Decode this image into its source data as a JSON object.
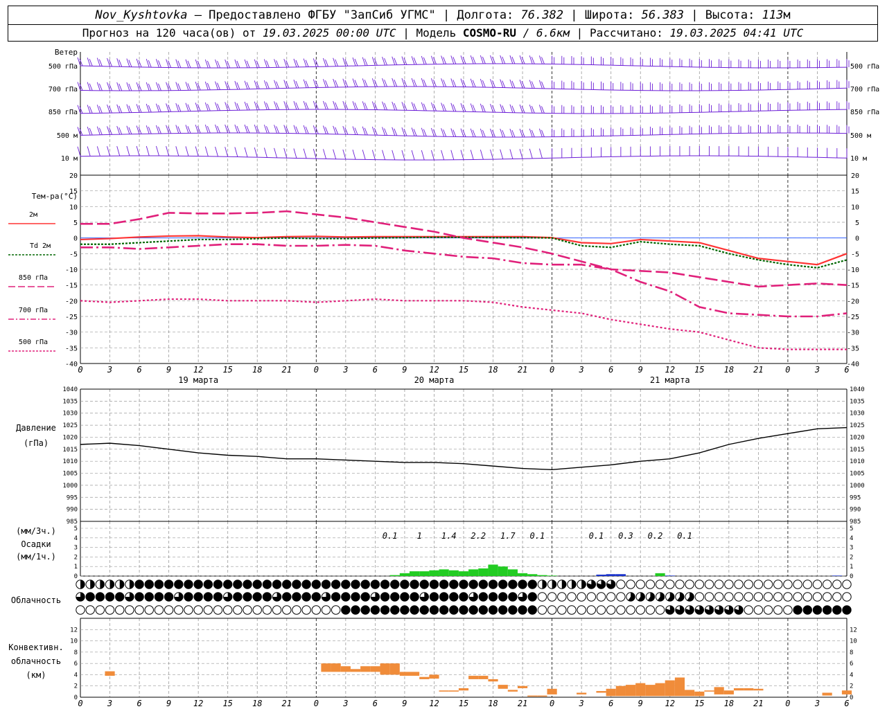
{
  "header": {
    "station": "Nov_Kyshtovka",
    "provider": "— Предоставлено ФГБУ \"ЗапСиб УГМС\"",
    "lon_label": "| Долгота:",
    "lon": "76.382",
    "lat_label": "| Широта:",
    "lat": "56.383",
    "alt_label": "| Высота:",
    "alt": "113",
    "alt_unit": "м",
    "forecast_label": "Прогноз на 120 часа(ов) от",
    "forecast_start": "19.03.2025 00:00 UTC",
    "model_label": "| Модель",
    "model": "COSMO-RU",
    "resolution": "/ 6.6км",
    "calc_label": "| Рассчитано:",
    "calc_time": "19.03.2025 04:41 UTC"
  },
  "labels": {
    "wind": "Ветер",
    "wind_levels": [
      "500 гПа",
      "700 гПа",
      "850 гПа",
      "500 м",
      "10 м"
    ],
    "temp": "Тем-ра(°С)",
    "temp_legend": [
      "2м",
      "Td 2м",
      "850 гПа",
      "700 гПа",
      "500 гПа"
    ],
    "pressure": "Давление",
    "pressure_unit": "(гПа)",
    "precip_3h": "(мм/3ч.)",
    "precip": "Осадки",
    "precip_1h": "(мм/1ч.)",
    "cloud": "Облачность",
    "conv1": "Конвективн.",
    "conv2": "облачность",
    "conv3": "(км)",
    "days": [
      "19 марта",
      "20 марта",
      "21 марта"
    ]
  },
  "chart_data": [
    {
      "type": "line",
      "title": "Тем-ра(°С)",
      "x_hours": [
        0,
        3,
        6,
        9,
        12,
        15,
        18,
        21,
        24,
        27,
        30,
        33,
        36,
        39,
        42,
        45,
        48,
        51,
        54,
        57,
        60,
        63,
        66,
        69,
        72,
        75,
        78
      ],
      "x_tick_labels": [
        "0",
        "3",
        "6",
        "9",
        "12",
        "15",
        "18",
        "21",
        "0",
        "3",
        "6",
        "9",
        "12",
        "15",
        "18",
        "21",
        "0",
        "3",
        "6",
        "9",
        "12",
        "15",
        "18",
        "21",
        "0",
        "3",
        "6"
      ],
      "ylim": [
        -40,
        20
      ],
      "y_ticks": [
        20,
        15,
        10,
        5,
        0,
        -5,
        -10,
        -15,
        -20,
        -25,
        -30,
        -35,
        -40
      ],
      "series": [
        {
          "name": "2м",
          "color": "#ff3333",
          "values": [
            -0.5,
            -0.2,
            0.3,
            0.6,
            0.7,
            0.3,
            0.1,
            0.4,
            0.5,
            0.3,
            0.4,
            0.4,
            0.4,
            0.4,
            0.4,
            0.4,
            0.1,
            -1.5,
            -1.8,
            -0.5,
            -1,
            -1.5,
            -4,
            -6.5,
            -7.5,
            -8.5,
            -5
          ]
        },
        {
          "name": "Td 2м",
          "color": "#006600",
          "values": [
            -2,
            -2,
            -1.5,
            -1,
            -0.5,
            -0.5,
            -0.2,
            0,
            -0.2,
            -0.2,
            0,
            0.1,
            0.2,
            0.2,
            0.1,
            0.1,
            0,
            -2.5,
            -3,
            -1.2,
            -2,
            -2.5,
            -5,
            -7,
            -8.5,
            -9.5,
            -7
          ]
        },
        {
          "name": "850 гПа",
          "color": "#e0207a",
          "values": [
            4.5,
            4.5,
            6,
            8,
            7.8,
            7.8,
            8,
            8.5,
            7.5,
            6.5,
            5,
            3.5,
            2,
            0,
            -1.5,
            -3,
            -5,
            -7.5,
            -10,
            -10.5,
            -11,
            -12.5,
            -14,
            -15.5,
            -15,
            -14.5,
            -15
          ]
        },
        {
          "name": "700 гПа",
          "color": "#e0207a",
          "values": [
            -3,
            -3,
            -3.5,
            -3,
            -2.5,
            -2,
            -2,
            -2.5,
            -2.5,
            -2.2,
            -2.5,
            -4,
            -5,
            -6,
            -6.5,
            -8,
            -8.5,
            -8.5,
            -10,
            -14,
            -17,
            -22,
            -24,
            -24.5,
            -25,
            -25,
            -24
          ]
        },
        {
          "name": "500 гПа",
          "color": "#e0207a",
          "values": [
            -20,
            -20.5,
            -20,
            -19.5,
            -19.5,
            -20,
            -20,
            -20,
            -20.5,
            -20,
            -19.5,
            -20,
            -20,
            -20,
            -20.5,
            -22,
            -23,
            -24,
            -26,
            -27.5,
            -29,
            -30,
            -32.5,
            -35,
            -35.5,
            -35.5,
            -35.5
          ]
        }
      ]
    },
    {
      "type": "line",
      "title": "Давление",
      "ylabel": "(гПа)",
      "ylim": [
        985,
        1040
      ],
      "y_ticks": [
        1040,
        1035,
        1030,
        1025,
        1020,
        1015,
        1010,
        1005,
        1000,
        995,
        990,
        985
      ],
      "x_hours": [
        0,
        3,
        6,
        9,
        12,
        15,
        18,
        21,
        24,
        27,
        30,
        33,
        36,
        39,
        42,
        45,
        48,
        51,
        54,
        57,
        60,
        63,
        66,
        69,
        72,
        75,
        78
      ],
      "values": [
        1017,
        1017.5,
        1016.5,
        1015,
        1013.5,
        1012.5,
        1012,
        1011,
        1011,
        1010.5,
        1010,
        1009.5,
        1009.5,
        1009,
        1008,
        1007,
        1006.5,
        1007.5,
        1008.5,
        1010,
        1011,
        1013.5,
        1017,
        1019.5,
        1021.5,
        1023.5,
        1024
      ]
    },
    {
      "type": "bar",
      "title": "Осадки",
      "ylim": [
        0,
        5
      ],
      "y_ticks": [
        5,
        4,
        3,
        2,
        1,
        0
      ],
      "amount_3h_labels": [
        {
          "hour": 31.5,
          "text": "0.1"
        },
        {
          "hour": 34.5,
          "text": "1"
        },
        {
          "hour": 37.5,
          "text": "1.4"
        },
        {
          "hour": 40.5,
          "text": "2.2"
        },
        {
          "hour": 43.5,
          "text": "1.7"
        },
        {
          "hour": 46.5,
          "text": "0.1"
        },
        {
          "hour": 52.5,
          "text": "0.1"
        },
        {
          "hour": 55.5,
          "text": "0.3"
        },
        {
          "hour": 58.5,
          "text": "0.2"
        },
        {
          "hour": 61.5,
          "text": "0.1"
        }
      ],
      "hourly": [
        {
          "hour": 32,
          "value": 0.1,
          "color": "#22cc22"
        },
        {
          "hour": 33,
          "value": 0.3,
          "color": "#22cc22"
        },
        {
          "hour": 34,
          "value": 0.5,
          "color": "#22cc22"
        },
        {
          "hour": 35,
          "value": 0.5,
          "color": "#22cc22"
        },
        {
          "hour": 36,
          "value": 0.6,
          "color": "#22cc22"
        },
        {
          "hour": 37,
          "value": 0.7,
          "color": "#22cc22"
        },
        {
          "hour": 38,
          "value": 0.6,
          "color": "#22cc22"
        },
        {
          "hour": 39,
          "value": 0.5,
          "color": "#22cc22"
        },
        {
          "hour": 40,
          "value": 0.7,
          "color": "#22cc22"
        },
        {
          "hour": 41,
          "value": 0.8,
          "color": "#22cc22"
        },
        {
          "hour": 42,
          "value": 1.2,
          "color": "#22cc22"
        },
        {
          "hour": 43,
          "value": 1.0,
          "color": "#22cc22"
        },
        {
          "hour": 44,
          "value": 0.7,
          "color": "#22cc22"
        },
        {
          "hour": 45,
          "value": 0.3,
          "color": "#22cc22"
        },
        {
          "hour": 46,
          "value": 0.2,
          "color": "#22cc22"
        },
        {
          "hour": 47,
          "value": 0.1,
          "color": "#22cc22"
        },
        {
          "hour": 48,
          "value": 0.05,
          "color": "#22cc22"
        },
        {
          "hour": 53,
          "value": 0.15,
          "color": "#1a33cc"
        },
        {
          "hour": 54,
          "value": 0.2,
          "color": "#1a33cc"
        },
        {
          "hour": 55,
          "value": 0.2,
          "color": "#1a33cc"
        },
        {
          "hour": 59,
          "value": 0.3,
          "color": "#22cc22"
        },
        {
          "hour": 60,
          "value": 0.05,
          "color": "#1a33cc"
        },
        {
          "hour": 77,
          "value": 0.05,
          "color": "#1a33cc"
        }
      ]
    },
    {
      "type": "bar",
      "title": "Конвективн. облачность (км)",
      "ylim": [
        0,
        14
      ],
      "y_ticks": [
        12,
        10,
        8,
        6,
        4,
        2,
        0
      ],
      "hourly_bars": [
        {
          "hour": 3,
          "base": 3.8,
          "top": 4.6
        },
        {
          "hour": 25,
          "base": 4.5,
          "top": 6
        },
        {
          "hour": 26,
          "base": 4.5,
          "top": 6
        },
        {
          "hour": 27,
          "base": 4.5,
          "top": 5.5
        },
        {
          "hour": 28,
          "base": 4.5,
          "top": 5
        },
        {
          "hour": 29,
          "base": 4.5,
          "top": 5.5
        },
        {
          "hour": 30,
          "base": 4.5,
          "top": 5.5
        },
        {
          "hour": 31,
          "base": 4,
          "top": 6
        },
        {
          "hour": 32,
          "base": 4,
          "top": 6
        },
        {
          "hour": 33,
          "base": 3.8,
          "top": 4.5
        },
        {
          "hour": 34,
          "base": 3.8,
          "top": 4.5
        },
        {
          "hour": 35,
          "base": 3.2,
          "top": 3.6
        },
        {
          "hour": 36,
          "base": 3.3,
          "top": 4
        },
        {
          "hour": 37,
          "base": 1,
          "top": 1.2
        },
        {
          "hour": 38,
          "base": 1,
          "top": 1.2
        },
        {
          "hour": 39,
          "base": 1.2,
          "top": 1.6
        },
        {
          "hour": 40,
          "base": 3.2,
          "top": 3.8
        },
        {
          "hour": 41,
          "base": 3.2,
          "top": 3.8
        },
        {
          "hour": 42,
          "base": 2.8,
          "top": 3.2
        },
        {
          "hour": 43,
          "base": 1.5,
          "top": 2.2
        },
        {
          "hour": 44,
          "base": 1,
          "top": 1.3
        },
        {
          "hour": 45,
          "base": 1.6,
          "top": 2
        },
        {
          "hour": 46,
          "base": 0.2,
          "top": 0.3
        },
        {
          "hour": 47,
          "base": 0.2,
          "top": 0.3
        },
        {
          "hour": 48,
          "base": 0.5,
          "top": 1.5
        },
        {
          "hour": 51,
          "base": 0.5,
          "top": 0.8
        },
        {
          "hour": 53,
          "base": 0.8,
          "top": 1.1
        },
        {
          "hour": 54,
          "base": 0.2,
          "top": 1.5
        },
        {
          "hour": 55,
          "base": 0.2,
          "top": 2
        },
        {
          "hour": 56,
          "base": 0.2,
          "top": 2.2
        },
        {
          "hour": 57,
          "base": 0.2,
          "top": 2.5
        },
        {
          "hour": 58,
          "base": 0.2,
          "top": 2.2
        },
        {
          "hour": 59,
          "base": 0.2,
          "top": 2.5
        },
        {
          "hour": 60,
          "base": 0.2,
          "top": 3
        },
        {
          "hour": 61,
          "base": 0.2,
          "top": 3.5
        },
        {
          "hour": 62,
          "base": 0.2,
          "top": 1.3
        },
        {
          "hour": 63,
          "base": 0.2,
          "top": 1
        },
        {
          "hour": 64,
          "base": 1,
          "top": 1.2
        },
        {
          "hour": 65,
          "base": 0.5,
          "top": 1.8
        },
        {
          "hour": 66,
          "base": 0.5,
          "top": 1.2
        },
        {
          "hour": 67,
          "base": 1.2,
          "top": 1.6
        },
        {
          "hour": 68,
          "base": 1.2,
          "top": 1.6
        },
        {
          "hour": 69,
          "base": 1.2,
          "top": 1.5
        },
        {
          "hour": 76,
          "base": 0.3,
          "top": 0.8
        },
        {
          "hour": 78,
          "base": 0.5,
          "top": 1.2
        }
      ]
    }
  ],
  "colors": {
    "wind": "#6a1bd6",
    "pressure": "#000000",
    "precip_rain": "#22cc22",
    "precip_snow": "#1a33cc",
    "convective": "#f08c3a",
    "grid": "#9a9a9a"
  }
}
